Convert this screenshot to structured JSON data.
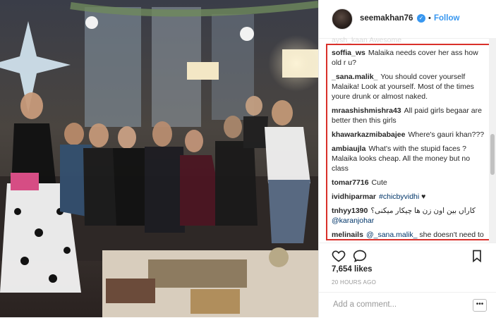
{
  "post": {
    "username": "seemakhan76",
    "follow_label": "Follow",
    "separator": "•",
    "verified_glyph": "✓",
    "cut_comment": "aysh_kaan Awesome",
    "likes": "7,654 likes",
    "time": "20 HOURS AGO",
    "add_comment_placeholder": "Add a comment...",
    "more_label": "•••"
  },
  "comments": [
    {
      "user": "soffia_ws",
      "text": "Malaika needs cover her ass how old r u?"
    },
    {
      "user": "_sana.malik_",
      "text": "You should cover yourself Malaika! Look at yourself. Most of the times youre drunk or almost naked."
    },
    {
      "user": "mraashishmishra43",
      "text": "All paid girls begaar are better then this girls"
    },
    {
      "user": "khawarkazmibabajee",
      "text": "Where's gauri khan???"
    },
    {
      "user": "ambiaujla",
      "text": "What's with the stupid faces ? Malaika looks cheap. All the money but no class"
    },
    {
      "user": "tomar7716",
      "text": "Cute"
    },
    {
      "user": "ividhiparmar",
      "link": "#chicbyvidhi",
      "text": "♥"
    },
    {
      "user": "tnhyy1390",
      "text": "کاراں بین اون زن ها چیکار میکنی؟",
      "link2": "@karanjohar"
    },
    {
      "user": "melinails",
      "link": "@_sana.malik_",
      "text": "she doesn't need to do shit"
    }
  ],
  "icons": [
    "heart-icon",
    "comment-icon",
    "bookmark-icon",
    "avatar",
    "verified-badge-icon"
  ],
  "colors": {
    "accent": "#3897f0",
    "highlight_border": "#d9302a",
    "link": "#003569"
  }
}
